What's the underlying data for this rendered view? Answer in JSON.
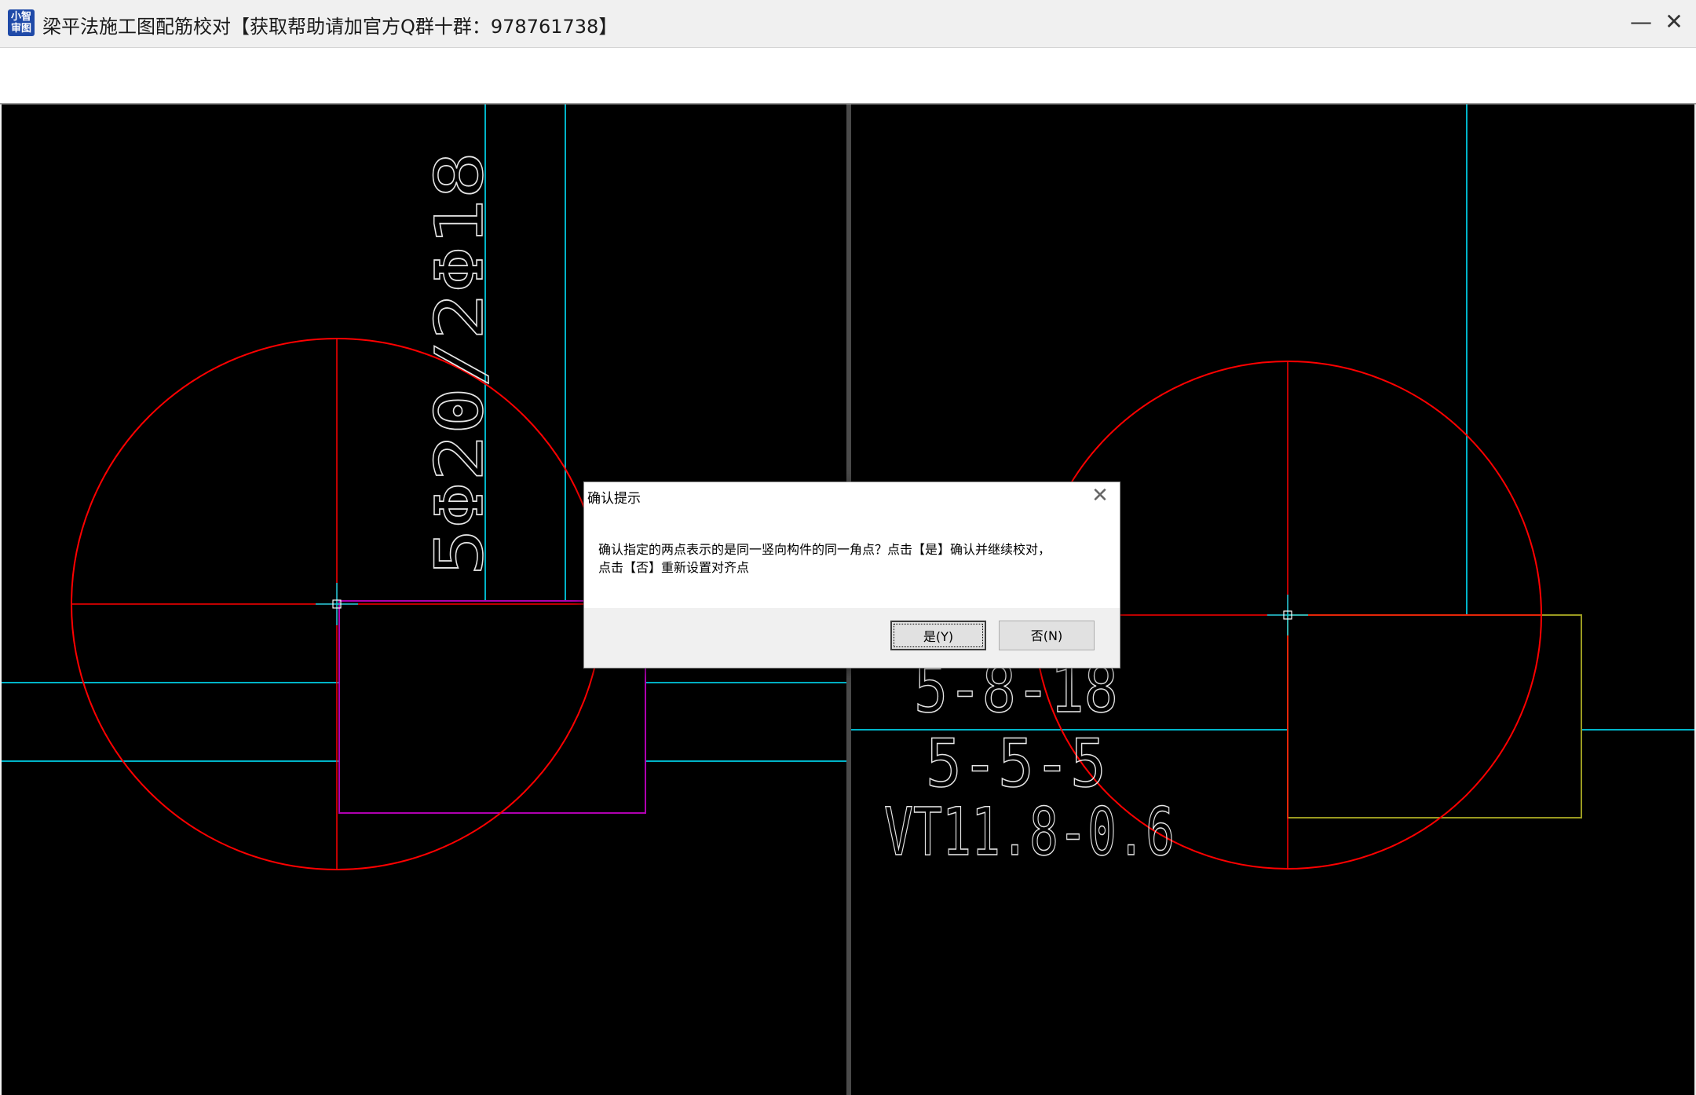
{
  "window": {
    "icon_line1": "小智",
    "icon_line2": "审图",
    "title": "梁平法施工图配筋校对【获取帮助请加官方Q群十群：978761738】",
    "minimize_glyph": "—",
    "close_glyph": "✕"
  },
  "left_view": {
    "rebar_label": "5Φ20/2Φ18"
  },
  "right_view": {
    "labels": [
      "5-8-18",
      "5-5-5",
      "VT11.8-0.6"
    ]
  },
  "colors": {
    "canvas_bg": "#000000",
    "circle": "#ff0000",
    "grid_line": "#00b4c8",
    "beam_outline_left": "#b000b0",
    "beam_outline_right": "#9a9a20",
    "cad_text": "#e6e6e6"
  },
  "dialog": {
    "title": "确认提示",
    "close_glyph": "✕",
    "message_line1": "确认指定的两点表示的是同一竖向构件的同一角点？点击【是】确认并继续校对，",
    "message_line2": "点击【否】重新设置对齐点",
    "yes_label": "是(Y)",
    "no_label": "否(N)"
  }
}
